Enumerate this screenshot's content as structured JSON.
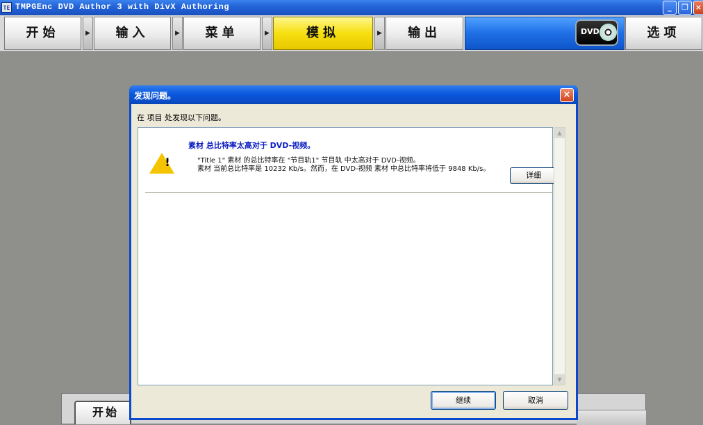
{
  "window": {
    "title": "TMPGEnc DVD Author 3 with DivX Authoring",
    "icon_text": "TE"
  },
  "nav": {
    "start": "开始",
    "input": "输入",
    "menu": "菜单",
    "simulate": "模拟",
    "output": "输出",
    "options": "选项",
    "logo_text": "DVD",
    "arrow": "▶"
  },
  "window_controls": {
    "minimize": "_",
    "maximize": "❐",
    "close": "×"
  },
  "bottom": {
    "start_label": "开始"
  },
  "dialog": {
    "title": "发现问题。",
    "description": "在 项目 处发现以下问题。",
    "problem": {
      "title": "素材 总比特率太高对于 DVD-视频。",
      "line1": "\"Title 1\" 素材 的总比特率在 \"节目轨1\" 节目轨 中太高对于 DVD-视频。",
      "line2": "素材 当前总比特率是 10232 Kb/s。然而，在 DVD-视频 素材 中总比特率将低于 9848 Kb/s。",
      "detail_label": "详细"
    },
    "ok_label": "继续",
    "cancel_label": "取消",
    "close_glyph": "×"
  },
  "scrollbar": {
    "up_glyph": "▲",
    "down_glyph": "▼"
  },
  "colors": {
    "accent_active": "#f6df10",
    "title_blue": "#0b58dd",
    "problem_title": "#0b1ec2",
    "warning": "#f5c400"
  }
}
